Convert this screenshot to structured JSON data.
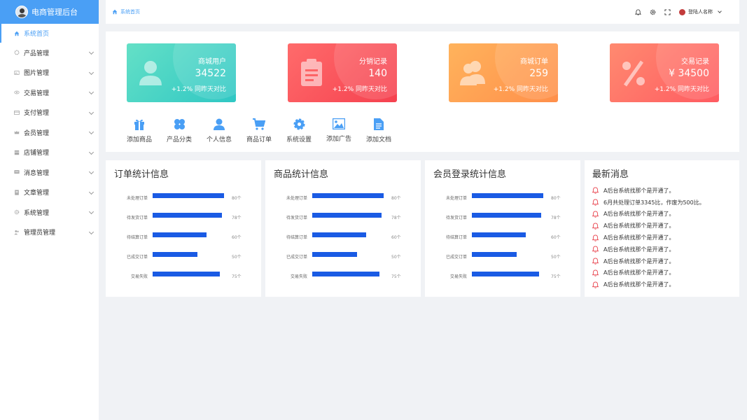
{
  "brand": {
    "title": "电商管理后台"
  },
  "sidebar": {
    "items": [
      {
        "label": "系统首页",
        "icon": "home-icon",
        "active": true
      },
      {
        "label": "产品管理",
        "icon": "gear-icon"
      },
      {
        "label": "图片管理",
        "icon": "image-icon"
      },
      {
        "label": "交易管理",
        "icon": "eye-icon"
      },
      {
        "label": "支付管理",
        "icon": "card-icon"
      },
      {
        "label": "会员管理",
        "icon": "crown-icon"
      },
      {
        "label": "店铺管理",
        "icon": "store-icon"
      },
      {
        "label": "消息管理",
        "icon": "message-icon"
      },
      {
        "label": "文章管理",
        "icon": "document-icon"
      },
      {
        "label": "系统管理",
        "icon": "settings-icon"
      },
      {
        "label": "管理员管理",
        "icon": "users-icon"
      }
    ]
  },
  "header": {
    "breadcrumb": "系统首页",
    "user_name": "登陆人名称"
  },
  "cards": [
    {
      "title": "商城用户",
      "value": "34522",
      "sub": "+1.2% 同昨天对比",
      "color_from": "#64e0c6",
      "color_to": "#2fc7c4",
      "icon": "user-icon"
    },
    {
      "title": "分销记录",
      "value": "140",
      "sub": "+1.2% 同昨天对比",
      "color_from": "#ff6b6b",
      "color_to": "#f5414f",
      "icon": "clipboard-icon"
    },
    {
      "title": "商城订单",
      "value": "259",
      "sub": "+1.2% 同昨天对比",
      "color_from": "#ffb35c",
      "color_to": "#ff8f4a",
      "icon": "users-icon"
    },
    {
      "title": "交易记录",
      "value": "¥ 34500",
      "sub": "+1.2% 同昨天对比",
      "color_from": "#ff8a70",
      "color_to": "#ff5b61",
      "icon": "percent-icon"
    }
  ],
  "quick_actions": [
    {
      "label": "添加商品",
      "icon": "gift-icon"
    },
    {
      "label": "产品分类",
      "icon": "category-icon"
    },
    {
      "label": "个人信息",
      "icon": "person-icon"
    },
    {
      "label": "商品订单",
      "icon": "cart-icon"
    },
    {
      "label": "系统设置",
      "icon": "settings-icon"
    },
    {
      "label": "添加广告",
      "icon": "picture-icon"
    },
    {
      "label": "添加文档",
      "icon": "file-icon"
    }
  ],
  "chart_data": [
    {
      "type": "bar",
      "title": "订单统计信息",
      "categories": [
        "未处理订单",
        "待发货订单",
        "待结算订单",
        "已成交订单",
        "交易失败"
      ],
      "values": [
        80,
        78,
        60,
        50,
        75
      ],
      "value_labels": [
        "80个",
        "78个",
        "60个",
        "50个",
        "75个"
      ],
      "orientation": "horizontal",
      "xlim": [
        0,
        80
      ],
      "color": "#1a5be4"
    },
    {
      "type": "bar",
      "title": "商品统计信息",
      "categories": [
        "未处理订单",
        "待发货订单",
        "待结算订单",
        "已成交订单",
        "交易失败"
      ],
      "values": [
        80,
        78,
        60,
        50,
        75
      ],
      "value_labels": [
        "80个",
        "78个",
        "60个",
        "50个",
        "75个"
      ],
      "orientation": "horizontal",
      "xlim": [
        0,
        80
      ],
      "color": "#1a5be4"
    },
    {
      "type": "bar",
      "title": "会员登录统计信息",
      "categories": [
        "未处理订单",
        "待发货订单",
        "待结算订单",
        "已成交订单",
        "交易失败"
      ],
      "values": [
        80,
        78,
        60,
        50,
        75
      ],
      "value_labels": [
        "80个",
        "78个",
        "60个",
        "50个",
        "75个"
      ],
      "orientation": "horizontal",
      "xlim": [
        0,
        80
      ],
      "color": "#1a5be4"
    }
  ],
  "news": {
    "title": "最新消息",
    "items": [
      "A后台系统找那个是开通了。",
      "6月共处理订单3345比，作废为500比。",
      "A后台系统找那个是开通了。",
      "A后台系统找那个是开通了。",
      "A后台系统找那个是开通了。",
      "A后台系统找那个是开通了。",
      "A后台系统找那个是开通了。",
      "A后台系统找那个是开通了。",
      "A后台系统找那个是开通了。"
    ]
  }
}
